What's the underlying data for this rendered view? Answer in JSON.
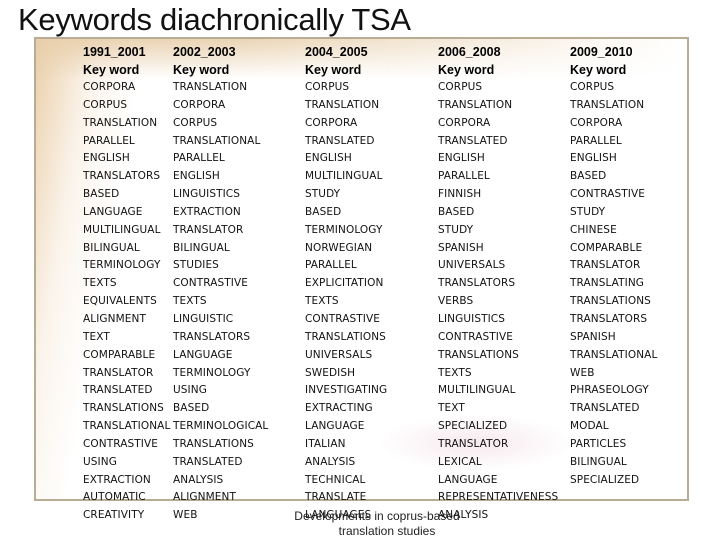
{
  "slide": {
    "title": "Keywords diachronically TSA",
    "footer_line1": "Developments in coprus-based",
    "footer_line2": "translation studies"
  },
  "table": {
    "columns": [
      {
        "period": "1991_2001",
        "header": "Key word",
        "keywords": [
          "CORPORA",
          "CORPUS",
          "TRANSLATION",
          "PARALLEL",
          "ENGLISH",
          "TRANSLATORS",
          "BASED",
          "LANGUAGE",
          "MULTILINGUAL",
          "BILINGUAL",
          "TERMINOLOGY",
          "TEXTS",
          "EQUIVALENTS",
          "ALIGNMENT",
          "TEXT",
          "COMPARABLE",
          "TRANSLATOR",
          "TRANSLATED",
          "TRANSLATIONS",
          "TRANSLATIONAL",
          "CONTRASTIVE",
          "USING",
          "EXTRACTION",
          "AUTOMATIC",
          "CREATIVITY"
        ]
      },
      {
        "period": "2002_2003",
        "header": "Key word",
        "keywords": [
          "TRANSLATION",
          "CORPORA",
          "CORPUS",
          "TRANSLATIONAL",
          "PARALLEL",
          "ENGLISH",
          "LINGUISTICS",
          "EXTRACTION",
          "TRANSLATOR",
          "BILINGUAL",
          "STUDIES",
          "CONTRASTIVE",
          "TEXTS",
          "LINGUISTIC",
          "TRANSLATORS",
          "LANGUAGE",
          "TERMINOLOGY",
          "USING",
          "BASED",
          "TERMINOLOGICAL",
          "TRANSLATIONS",
          "TRANSLATED",
          "ANALYSIS",
          "ALIGNMENT",
          "WEB"
        ]
      },
      {
        "period": "2004_2005",
        "header": "Key word",
        "keywords": [
          "CORPUS",
          "TRANSLATION",
          "CORPORA",
          "TRANSLATED",
          "ENGLISH",
          "MULTILINGUAL",
          "STUDY",
          "BASED",
          "TERMINOLOGY",
          "NORWEGIAN",
          "PARALLEL",
          "EXPLICITATION",
          "TEXTS",
          "CONTRASTIVE",
          "TRANSLATIONS",
          "UNIVERSALS",
          "SWEDISH",
          "INVESTIGATING",
          "EXTRACTING",
          "LANGUAGE",
          "ITALIAN",
          "ANALYSIS",
          "TECHNICAL",
          "TRANSLATE",
          "LANGUAGES"
        ]
      },
      {
        "period": "2006_2008",
        "header": "Key word",
        "keywords": [
          "CORPUS",
          "TRANSLATION",
          "CORPORA",
          "TRANSLATED",
          "ENGLISH",
          "PARALLEL",
          "FINNISH",
          "BASED",
          "STUDY",
          "SPANISH",
          "UNIVERSALS",
          "TRANSLATORS",
          "VERBS",
          "LINGUISTICS",
          "CONTRASTIVE",
          "TRANSLATIONS",
          "TEXTS",
          "MULTILINGUAL",
          "TEXT",
          "SPECIALIZED",
          "TRANSLATOR",
          "LEXICAL",
          "LANGUAGE",
          "REPRESENTATIVENESS",
          "ANALYSIS"
        ]
      },
      {
        "period": "2009_2010",
        "header": "Key word",
        "keywords": [
          "CORPUS",
          "TRANSLATION",
          "CORPORA",
          "PARALLEL",
          "ENGLISH",
          "BASED",
          "CONTRASTIVE",
          "STUDY",
          "CHINESE",
          "COMPARABLE",
          "TRANSLATOR",
          "TRANSLATING",
          "TRANSLATIONS",
          "TRANSLATORS",
          "SPANISH",
          "TRANSLATIONAL",
          "WEB",
          "PHRASEOLOGY",
          "TRANSLATED",
          "MODAL",
          "PARTICLES",
          "BILINGUAL",
          "SPECIALIZED"
        ]
      }
    ]
  }
}
